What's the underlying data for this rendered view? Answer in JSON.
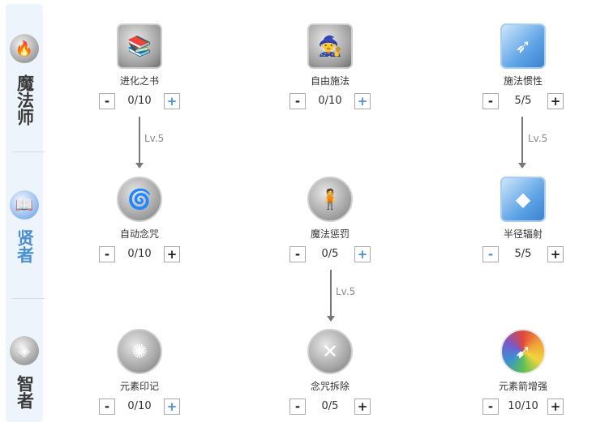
{
  "classes": [
    {
      "name": "魔法师",
      "icon": "mage-flame-icon",
      "active": false
    },
    {
      "name": "贤者",
      "icon": "sage-book-icon",
      "active": true
    },
    {
      "name": "智者",
      "icon": "wise-crystal-icon",
      "active": false
    }
  ],
  "skills": [
    {
      "name": "进化之书",
      "value": "0/10",
      "icon": "book-icon"
    },
    {
      "name": "自由施法",
      "value": "0/10",
      "icon": "free-cast-icon"
    },
    {
      "name": "施法惯性",
      "value": "5/5",
      "icon": "cast-inertia-icon"
    },
    {
      "name": "自动念咒",
      "value": "0/10",
      "icon": "auto-chant-icon"
    },
    {
      "name": "魔法惩罚",
      "value": "0/5",
      "icon": "magic-punish-icon"
    },
    {
      "name": "半径辐射",
      "value": "5/5",
      "icon": "radius-radiate-icon"
    },
    {
      "name": "元素印记",
      "value": "0/10",
      "icon": "element-mark-icon"
    },
    {
      "name": "念咒拆除",
      "value": "0/5",
      "icon": "chant-dismantle-icon"
    },
    {
      "name": "元素箭增强",
      "value": "10/10",
      "icon": "element-arrow-icon"
    }
  ],
  "buttons": {
    "minus": "-",
    "plus": "+"
  },
  "links": [
    {
      "label": "Lv.5"
    },
    {
      "label": "Lv.5"
    },
    {
      "label": "Lv.5"
    }
  ],
  "colors": {
    "accent": "#4a90d9",
    "sidebar_bg": "#eef4fc"
  }
}
